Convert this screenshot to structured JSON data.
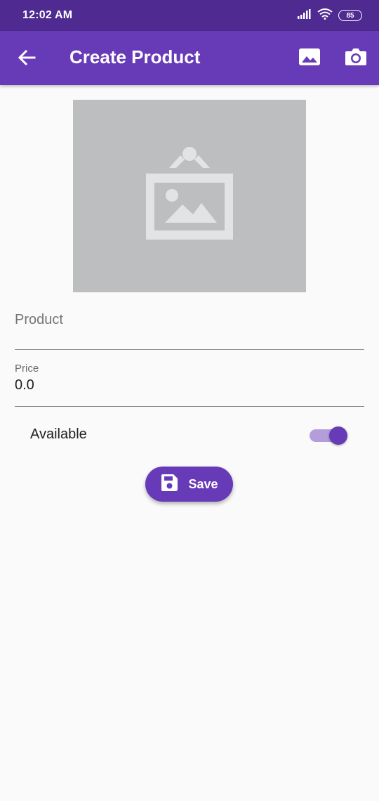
{
  "status_bar": {
    "time": "12:02 AM",
    "battery": "85",
    "icons": [
      "signal-icon",
      "wifi-icon",
      "battery-icon"
    ]
  },
  "app_bar": {
    "title": "Create Product",
    "back_icon": "arrow-back-icon",
    "actions": [
      "image-icon",
      "camera-icon"
    ],
    "color": "#673ab7"
  },
  "image_placeholder": {
    "icon": "framed-picture-icon",
    "color": "#bdbebf"
  },
  "form": {
    "product": {
      "placeholder": "Product",
      "value": ""
    },
    "price": {
      "label": "Price",
      "value": "0.0"
    },
    "available": {
      "label": "Available",
      "on": true
    },
    "save_label": "Save"
  },
  "colors": {
    "primary": "#673ab7",
    "status_bar": "#4e2a91",
    "switch_track": "#b39ddb"
  }
}
